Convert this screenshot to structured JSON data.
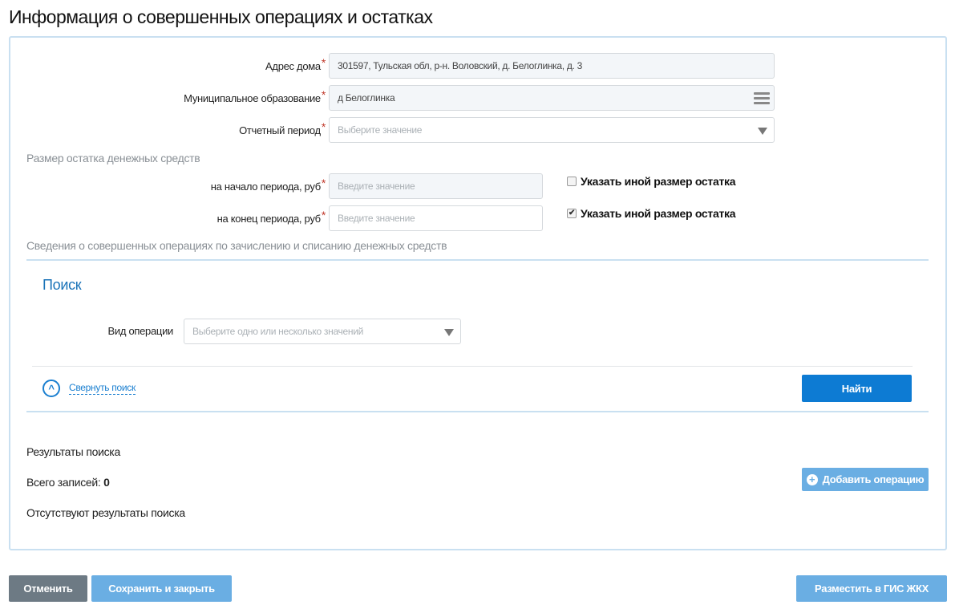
{
  "title": "Информация о совершенных операциях и остатках",
  "form": {
    "address": {
      "label": "Адрес дома",
      "value": "301597, Тульская обл, р-н. Воловский, д. Белоглинка, д. 3"
    },
    "municipality": {
      "label": "Муниципальное образование",
      "value": "д Белоглинка"
    },
    "period": {
      "label": "Отчетный период",
      "placeholder": "Выберите значение"
    },
    "required_mark": "*"
  },
  "balance": {
    "heading": "Размер остатка денежных средств",
    "start": {
      "label": "на начало периода, руб",
      "placeholder": "Введите значение",
      "checkbox_label": "Указать иной размер остатка",
      "checked": false
    },
    "end": {
      "label": "на конец периода, руб",
      "placeholder": "Введите значение",
      "checkbox_label": "Указать иной размер остатка",
      "checked": true
    }
  },
  "operations_heading": "Сведения о совершенных операциях по зачислению и списанию денежных средств",
  "search": {
    "title": "Поиск",
    "op_type_label": "Вид операции",
    "op_type_placeholder": "Выберите одно или несколько значений",
    "collapse_label": "Свернуть поиск",
    "find_label": "Найти"
  },
  "results": {
    "heading": "Результаты поиска",
    "total_label": "Всего записей:",
    "total": "0",
    "empty": "Отсутствуют результаты поиска",
    "add_label": "Добавить операцию"
  },
  "footer": {
    "cancel": "Отменить",
    "save_close": "Сохранить и закрыть",
    "publish": "Разместить в ГИС ЖКХ"
  },
  "colors": {
    "primary": "#0d7bd3",
    "light": "#6aaee3",
    "gray": "#6d7a84"
  }
}
